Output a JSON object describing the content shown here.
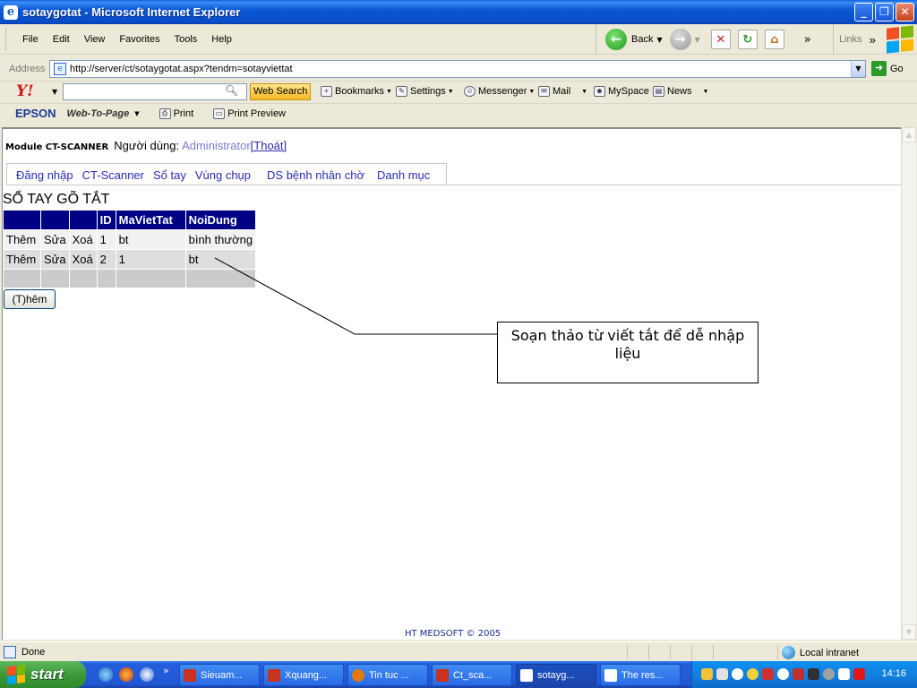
{
  "window": {
    "title": "sotaygotat - Microsoft Internet Explorer",
    "min_glyph": "_",
    "max_glyph": "❐",
    "close_glyph": "✕"
  },
  "menu": {
    "items": [
      "File",
      "Edit",
      "View",
      "Favorites",
      "Tools",
      "Help"
    ]
  },
  "nav": {
    "back_label": "Back",
    "more": "»",
    "links_label": "Links"
  },
  "address": {
    "label": "Address",
    "url": "http://server/ct/sotaygotat.aspx?tendm=sotayviettat",
    "go_label": "Go"
  },
  "yahoo_toolbar": {
    "logo": "Y!",
    "search_value": "",
    "web_search_label": "Web Search",
    "bookmarks_label": "Bookmarks",
    "settings_label": "Settings",
    "messenger_label": "Messenger",
    "mail_label": "Mail",
    "myspace_label": "MySpace",
    "news_label": "News"
  },
  "epson_toolbar": {
    "logo": "EPSON",
    "web_to_page_label": "Web-To-Page",
    "print_label": "Print",
    "print_preview_label": "Print Preview"
  },
  "page": {
    "module_name": "Module CT-SCANNER",
    "user_label": "Người dùng:",
    "user_name": "Administrator",
    "logout_label": "[Thoát]",
    "tabs": [
      "Đăng nhập",
      "CT-Scanner",
      "Sổ tay",
      "Vùng chụp",
      "DS bệnh nhân chờ",
      "Danh mục"
    ],
    "heading": "SỔ TAY GÕ TẮT",
    "table": {
      "headers": [
        "",
        "",
        "",
        "ID",
        "MaVietTat",
        "NoiDung"
      ],
      "rows": [
        {
          "add": "Thêm",
          "edit": "Sửa",
          "delete": "Xoá",
          "id": "1",
          "code": "bt",
          "content": "bình thường"
        },
        {
          "add": "Thêm",
          "edit": "Sửa",
          "delete": "Xoá",
          "id": "2",
          "code": "1",
          "content": "bt"
        }
      ]
    },
    "add_button_label": "(T)hêm",
    "callout_text": "Soạn thảo từ viết tắt để dễ nhập liệu",
    "footer": "HT MEDSOFT © 2005"
  },
  "status": {
    "text": "Done",
    "zone": "Local intranet"
  },
  "taskbar": {
    "start_label": "start",
    "buttons": [
      {
        "label": "Sieuam...",
        "color": "#c8321e",
        "active": false
      },
      {
        "label": "Xquang...",
        "color": "#c8321e",
        "active": false
      },
      {
        "label": "Tin tuc ...",
        "color": "#e07a10",
        "active": false
      },
      {
        "label": "Ct_sca...",
        "color": "#c8321e",
        "active": false
      },
      {
        "label": "sotayg...",
        "color": "#2a6ac8",
        "active": true
      },
      {
        "label": "The res...",
        "color": "#2a6ac8",
        "active": false
      }
    ],
    "clock": "14:16"
  }
}
